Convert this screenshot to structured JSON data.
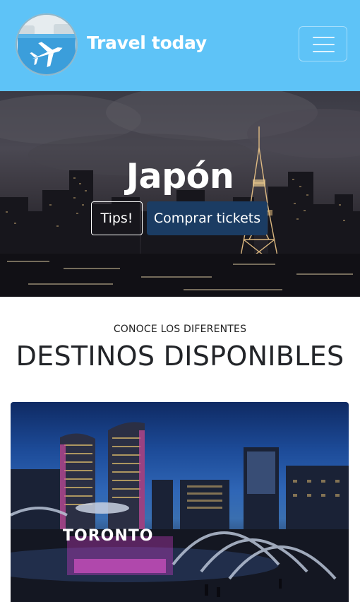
{
  "navbar": {
    "brand": "Travel today",
    "logo_icon": "airplane-icon",
    "menu_icon": "hamburger-icon",
    "bg_color": "#5ec3f7"
  },
  "hero": {
    "title": "Japón",
    "tips_label": "Tips!",
    "buy_label": "Comprar tickets",
    "buy_color": "#1b3c63"
  },
  "section": {
    "kicker": "CONOCE LOS DIFERENTES",
    "title": "DESTINOS DISPONIBLES"
  },
  "card": {
    "sign_text": "TORONTO"
  }
}
